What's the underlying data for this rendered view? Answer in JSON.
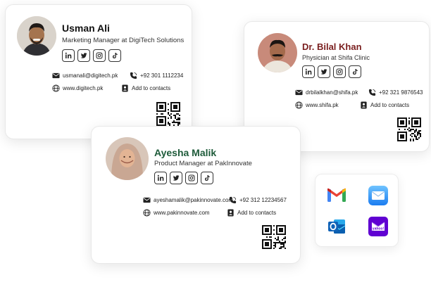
{
  "cards": {
    "usman": {
      "name": "Usman Ali",
      "role": "Marketing Manager at DigiTech Solutions",
      "email": "usmanali@digitech.pk",
      "phone": "+92 301 1112234",
      "website": "www.digitech.pk",
      "contacts_label": "Add to contacts",
      "name_color": "#111111"
    },
    "bilal": {
      "name": "Dr. Bilal Khan",
      "role": "Physician at Shifa Clinic",
      "email": "drbilalkhan@shifa.pk",
      "phone": "+92 321 9876543",
      "website": "www.shifa.pk",
      "contacts_label": "Add to contacts",
      "name_color": "#7a1f1f"
    },
    "ayesha": {
      "name": "Ayesha Malik",
      "role": "Product Manager at PakInnovate",
      "email": "ayeshamalik@pakinnovate.com",
      "phone": "+92 312 12234567",
      "website": "www.pakinnovate.com",
      "contacts_label": "Add to contacts",
      "name_color": "#1e5b3a"
    }
  },
  "social_icons": [
    "linkedin-icon",
    "twitter-icon",
    "instagram-icon",
    "tiktok-icon"
  ],
  "email_clients": [
    "gmail-icon",
    "apple-mail-icon",
    "outlook-icon",
    "yahoo-mail-icon"
  ],
  "yahoo_label": "yahoo!"
}
